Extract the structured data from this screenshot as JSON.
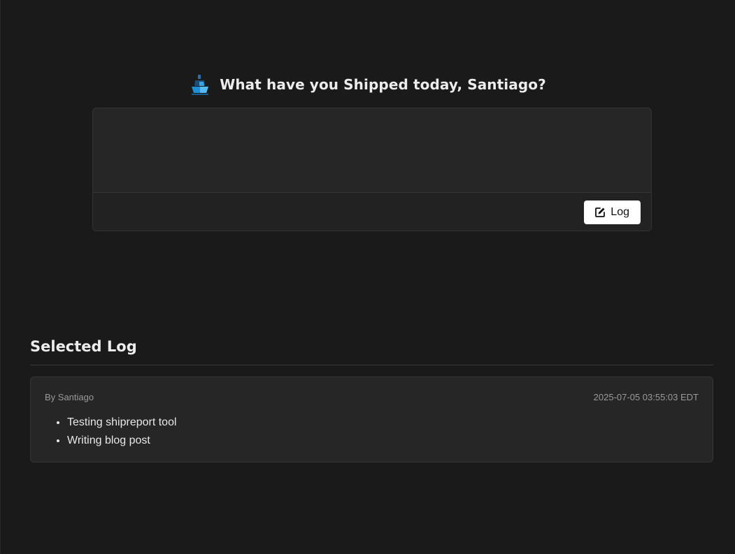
{
  "compose": {
    "icon": "ship-icon",
    "title": "What have you Shipped today, Santiago?",
    "textarea_value": "",
    "log_button_label": "Log",
    "log_button_icon": "edit-icon"
  },
  "selected_log": {
    "heading": "Selected Log",
    "author": "By Santiago",
    "timestamp": "2025-07-05 03:55:03 EDT",
    "items": [
      "Testing shipreport tool",
      "Writing blog post"
    ]
  },
  "colors": {
    "background": "#1a1a1a",
    "card": "#262626",
    "button": "#ffffff",
    "ship_accent": "#1e8fd6"
  }
}
